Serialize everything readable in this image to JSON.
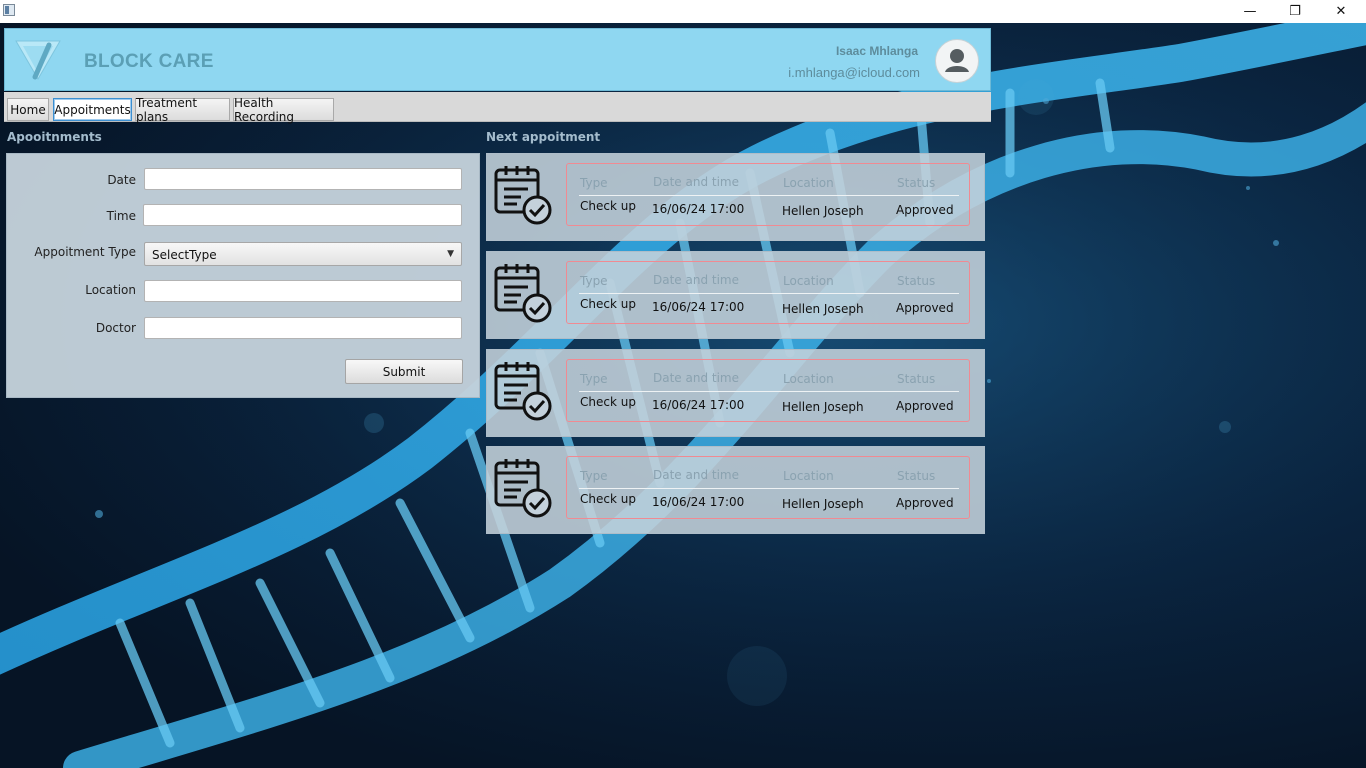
{
  "header": {
    "brand": "BLOCK CARE",
    "user_name": "Isaac Mhlanga",
    "user_email": "i.mhlanga@icloud.com"
  },
  "tabs": [
    "Home",
    "Appoitments",
    "Treatment plans",
    "Health Recording"
  ],
  "active_tab": "Appoitments",
  "form": {
    "title": "Apooitnments",
    "date_label": "Date",
    "date_value": "",
    "time_label": "Time",
    "time_value": "",
    "type_label": "Appoitment Type",
    "type_value": "SelectType",
    "location_label": "Location",
    "location_value": "",
    "doctor_label": "Doctor",
    "doctor_value": "",
    "submit_label": "Submit"
  },
  "next": {
    "title": "Next appoitment",
    "col_type": "Type",
    "col_datetime": "Date and time",
    "col_location": "Location",
    "col_status": "Status",
    "cards": [
      {
        "type": "Check up",
        "datetime": "16/06/24 17:00",
        "location": "Hellen Joseph",
        "status": "Approved"
      },
      {
        "type": "Check up",
        "datetime": "16/06/24 17:00",
        "location": "Hellen Joseph",
        "status": "Approved"
      },
      {
        "type": "Check up",
        "datetime": "16/06/24 17:00",
        "location": "Hellen Joseph",
        "status": "Approved"
      },
      {
        "type": "Check up",
        "datetime": "16/06/24 17:00",
        "location": "Hellen Joseph",
        "status": "Approved"
      }
    ]
  },
  "window": {
    "minimize_glyph": "—",
    "maximize_glyph": "❐",
    "close_glyph": "✕"
  },
  "colors": {
    "header_bg": "#8fd7f1",
    "panel_bg": "#c4d1db",
    "card_border": "#f08a92",
    "background": "#071524"
  }
}
